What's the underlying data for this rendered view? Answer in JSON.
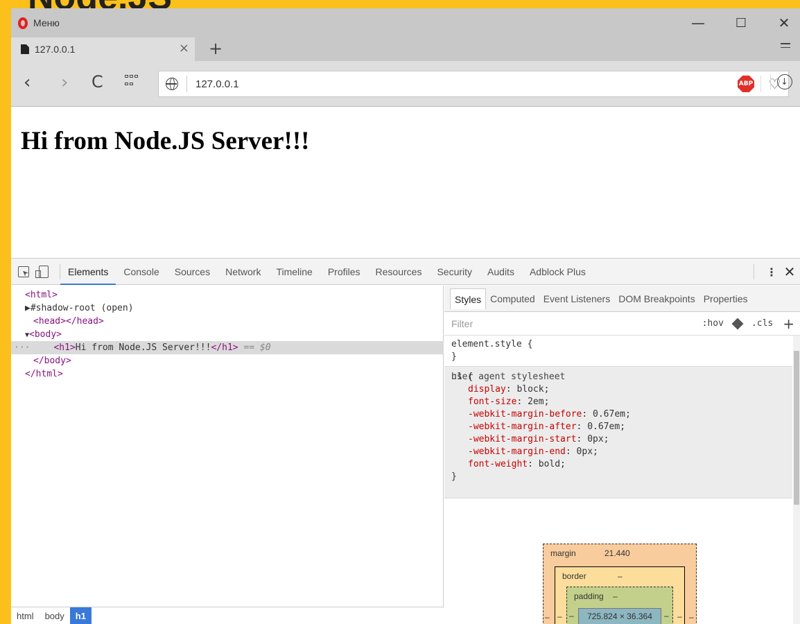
{
  "background_heading": "Node.JS",
  "window": {
    "menu_label": "Меню",
    "controls": {
      "minimize": "—",
      "maximize": "☐",
      "close": "✕"
    }
  },
  "tab": {
    "title": "127.0.0.1",
    "close": "×",
    "new_tab": "+"
  },
  "nav": {
    "back": "‹",
    "forward": "›",
    "reload": "C",
    "url": "127.0.0.1",
    "heart": "♡",
    "adblock": "ABP",
    "download": "↓"
  },
  "page": {
    "heading": "Hi from Node.JS Server!!!"
  },
  "devtools": {
    "tabs": [
      "Elements",
      "Console",
      "Sources",
      "Network",
      "Timeline",
      "Profiles",
      "Resources",
      "Security",
      "Audits",
      "Adblock Plus"
    ],
    "active_tab": "Elements",
    "more": "⋮",
    "close": "✕",
    "dom": {
      "html_open": "<html>",
      "shadow_root": "#shadow-root (open)",
      "head": "<head></head>",
      "body_open": "<body>",
      "h1_open": "<h1>",
      "h1_text": "Hi from Node.JS Server!!!",
      "h1_close": "</h1>",
      "h1_marker": " == $0",
      "dots": "···",
      "body_close": "</body>",
      "html_close": "</html>"
    },
    "breadcrumbs": [
      "html",
      "body",
      "h1"
    ],
    "styles": {
      "tabs": [
        "Styles",
        "Computed",
        "Event Listeners",
        "DOM Breakpoints",
        "Properties"
      ],
      "filter_placeholder": "Filter",
      "hov": ":hov",
      "cls": ".cls",
      "add": "+",
      "element_style": "element.style {",
      "close_brace": "}",
      "h1_selector": "h1 {",
      "source": "user agent stylesheet",
      "declarations": [
        {
          "prop": "display",
          "value": "block;"
        },
        {
          "prop": "font-size",
          "value": "2em;"
        },
        {
          "prop": "-webkit-margin-before",
          "value": "0.67em;"
        },
        {
          "prop": "-webkit-margin-after",
          "value": "0.67em;"
        },
        {
          "prop": "-webkit-margin-start",
          "value": "0px;"
        },
        {
          "prop": "-webkit-margin-end",
          "value": "0px;"
        },
        {
          "prop": "font-weight",
          "value": "bold;"
        }
      ],
      "box_model": {
        "margin_label": "margin",
        "margin_value": "21.440",
        "border_label": "border",
        "border_value": "–",
        "padding_label": "padding",
        "padding_value": "–",
        "content": "725.824 × 36.364",
        "dash": "–"
      }
    }
  }
}
